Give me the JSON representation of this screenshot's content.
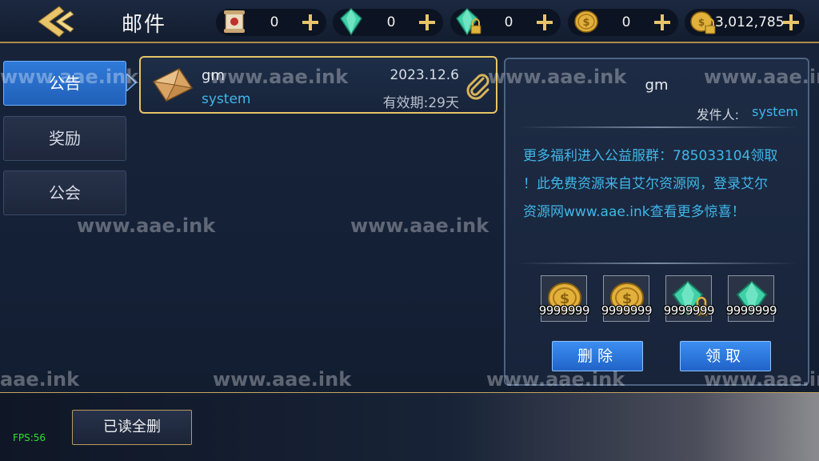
{
  "header": {
    "title": "邮件",
    "currencies": [
      {
        "icon": "scroll-ticket-icon",
        "value": "0"
      },
      {
        "icon": "green-gem-icon",
        "value": "0"
      },
      {
        "icon": "locked-green-gem-icon",
        "value": "0"
      },
      {
        "icon": "gold-coin-icon",
        "value": "0"
      },
      {
        "icon": "locked-gold-coin-icon",
        "value": "3,012,785"
      }
    ]
  },
  "tabs": [
    {
      "label": "公告",
      "active": true
    },
    {
      "label": "奖励",
      "active": false
    },
    {
      "label": "公会",
      "active": false
    }
  ],
  "mail_list": [
    {
      "from": "gm",
      "subtitle": "system",
      "date": "2023.12.6",
      "expiry": "有效期:29天",
      "has_attachment": true
    }
  ],
  "detail": {
    "title": "gm",
    "sender_label": "发件人:",
    "sender": "system",
    "body_lines": [
      "更多福利进入公益服群：785033104领取",
      "！此免费资源来自艾尔资源网，登录艾尔",
      "资源网www.aae.ink查看更多惊喜！"
    ],
    "attachments": [
      {
        "icon": "gold-coin-icon",
        "qty": "9999999"
      },
      {
        "icon": "gold-coin-icon",
        "qty": "9999999"
      },
      {
        "icon": "locked-green-gem-icon",
        "qty": "9999999"
      },
      {
        "icon": "green-gem-icon",
        "qty": "9999999"
      }
    ],
    "delete_label": "删除",
    "claim_label": "领取"
  },
  "footer": {
    "clear_all_label": "已读全删",
    "fps": "FPS:56"
  },
  "watermarks": [
    "www.aae.ink",
    "www.aae.ink",
    "www.aae.ink",
    "www.aae.ink",
    "www.aae.ink",
    "www.aae.ink",
    "aae.ink",
    "www.aae.ink",
    "www.aae.ink",
    "www.aae.ink"
  ],
  "colors": {
    "accent_blue": "#2f7ad8",
    "link_cyan": "#3fb7ea",
    "gold_border": "#e7c463"
  }
}
